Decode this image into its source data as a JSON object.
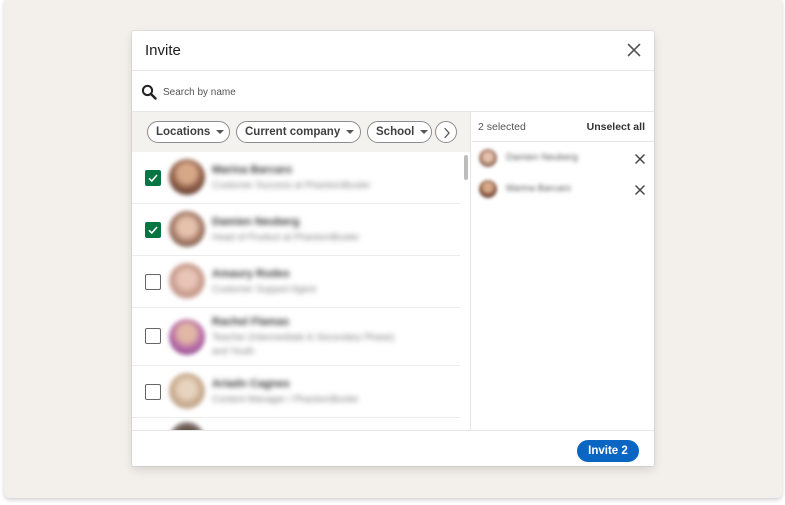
{
  "dialog": {
    "title": "Invite",
    "search_placeholder": "Search by name"
  },
  "filters": [
    {
      "label": "Locations"
    },
    {
      "label": "Current company"
    },
    {
      "label": "School"
    }
  ],
  "people": [
    {
      "name": "Marina Barcaro",
      "subtitle": "Customer Success at PhantomBuster",
      "checked": true
    },
    {
      "name": "Damien Neuberg",
      "subtitle": "Head of Product at PhantomBuster",
      "checked": true
    },
    {
      "name": "Amaury Rodes",
      "subtitle": "Customer Support Agent",
      "checked": false
    },
    {
      "name": "Rachel Flamas",
      "subtitle": "Teacher (Intermediate & Secondary Phase) and Youth",
      "checked": false
    },
    {
      "name": "Ariadn Cagnes",
      "subtitle": "Content Manager / PhantomBuster",
      "checked": false
    },
    {
      "name": "",
      "subtitle": "",
      "checked": false
    }
  ],
  "selection": {
    "count_text": "2 selected",
    "unselect_label": "Unselect all",
    "items": [
      {
        "name": "Damien Neuberg"
      },
      {
        "name": "Marina Barcaro"
      }
    ]
  },
  "footer": {
    "invite_label": "Invite 2"
  },
  "colors": {
    "accent": "#0a66c2",
    "checked": "#057642"
  }
}
